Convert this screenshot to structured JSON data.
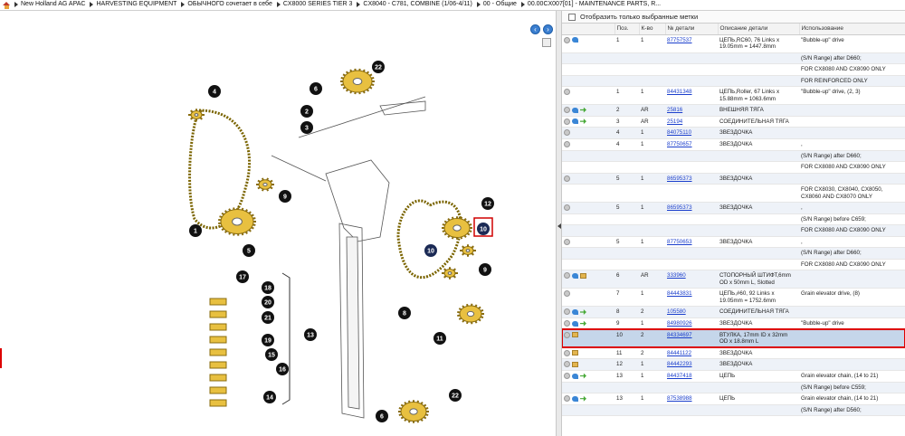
{
  "breadcrumb": [
    "New Holland AG APAC",
    "HARVESTING EQUIPMENT",
    "ОБЫЧНОГО сочетает в себе",
    "CX8000 SERIES TIER 3",
    "CX8040 - C781, COMBINE (1/06-4/11)",
    "00 - Общие",
    "00.00CX007[01] - MAINTENANCE PARTS, R..."
  ],
  "diagram": {
    "callouts": [
      "22",
      "4",
      "6",
      "2",
      "3",
      "9",
      "1",
      "12",
      "5",
      "10",
      "10",
      "9",
      "17",
      "18",
      "20",
      "21",
      "19",
      "15",
      "16",
      "14",
      "13",
      "8",
      "11",
      "6",
      "22"
    ],
    "colors": {
      "part": "#e8c040",
      "callout": "#111111",
      "highlight": "#d00000"
    }
  },
  "filter_label": "Отобразить только выбранные метки",
  "columns": [
    "",
    "Поз.",
    "К-во",
    "№ детали",
    "Описание детали",
    "Использование"
  ],
  "rows": [
    {
      "icons": [
        "circle",
        "blue"
      ],
      "pos": "1",
      "qty": "1",
      "part": "87757537",
      "desc": "ЦЕПЬ,RC60, 76 Links x 19.05mm = 1447.8mm",
      "use": "\"Bubble-up\" drive"
    },
    {
      "icons": [],
      "pos": "",
      "qty": "",
      "part": "",
      "desc": "",
      "use": "(S/N Range) after D660;"
    },
    {
      "icons": [],
      "pos": "",
      "qty": "",
      "part": "",
      "desc": "",
      "use": "FOR CX8080 AND CX8090 ONLY"
    },
    {
      "icons": [],
      "pos": "",
      "qty": "",
      "part": "",
      "desc": "",
      "use": "FOR REINFORCED ONLY"
    },
    {
      "icons": [
        "circle"
      ],
      "pos": "1",
      "qty": "1",
      "part": "84431348",
      "desc": "ЦЕПЬ,Roller, 67 Links x 15.88mm = 1063.6mm",
      "use": "\"Bubble-up\" drive, (2, 3)"
    },
    {
      "icons": [
        "circle",
        "blue",
        "green"
      ],
      "pos": "2",
      "qty": "AR",
      "part": "25816",
      "desc": "ВНЕШНЯЯ ТЯГА",
      "use": ""
    },
    {
      "icons": [
        "circle",
        "blue",
        "green"
      ],
      "pos": "3",
      "qty": "AR",
      "part": "25194",
      "desc": "СОЕДИНИТЕЛЬНАЯ ТЯГА",
      "use": ""
    },
    {
      "icons": [
        "circle"
      ],
      "pos": "4",
      "qty": "1",
      "part": "84075110",
      "desc": "ЗВЕЗДОЧКА",
      "use": ""
    },
    {
      "icons": [
        "circle"
      ],
      "pos": "4",
      "qty": "1",
      "part": "87750657",
      "desc": "ЗВЕЗДОЧКА",
      "use": ","
    },
    {
      "icons": [],
      "pos": "",
      "qty": "",
      "part": "",
      "desc": "",
      "use": "(S/N Range) after D660;"
    },
    {
      "icons": [],
      "pos": "",
      "qty": "",
      "part": "",
      "desc": "",
      "use": "FOR CX8080 AND CX8090 ONLY"
    },
    {
      "icons": [
        "circle"
      ],
      "pos": "5",
      "qty": "1",
      "part": "86595373",
      "desc": "ЗВЕЗДОЧКА",
      "use": ""
    },
    {
      "icons": [],
      "pos": "",
      "qty": "",
      "part": "",
      "desc": "",
      "use": "FOR CX8030, CX8040, CX8050, CX8060 AND CX8070 ONLY"
    },
    {
      "icons": [
        "circle"
      ],
      "pos": "5",
      "qty": "1",
      "part": "86595373",
      "desc": "ЗВЕЗДОЧКА",
      "use": ","
    },
    {
      "icons": [],
      "pos": "",
      "qty": "",
      "part": "",
      "desc": "",
      "use": "(S/N Range) before C659;"
    },
    {
      "icons": [],
      "pos": "",
      "qty": "",
      "part": "",
      "desc": "",
      "use": "FOR CX8080 AND CX8090 ONLY"
    },
    {
      "icons": [
        "circle"
      ],
      "pos": "5",
      "qty": "1",
      "part": "87750653",
      "desc": "ЗВЕЗДОЧКА",
      "use": ","
    },
    {
      "icons": [],
      "pos": "",
      "qty": "",
      "part": "",
      "desc": "",
      "use": "(S/N Range) after D660;"
    },
    {
      "icons": [],
      "pos": "",
      "qty": "",
      "part": "",
      "desc": "",
      "use": "FOR CX8080 AND CX8090 ONLY"
    },
    {
      "icons": [
        "circle",
        "blue",
        "box"
      ],
      "pos": "6",
      "qty": "AR",
      "part": "333960",
      "desc": "СТОПОРНЫЙ ШТИФТ,6mm OD x 50mm L, Slotted",
      "use": ""
    },
    {
      "icons": [
        "circle"
      ],
      "pos": "7",
      "qty": "1",
      "part": "84443831",
      "desc": "ЦЕПЬ,#60, 92 Links x 19.05mm = 1752.6mm",
      "use": "Grain elevator drive, (8)"
    },
    {
      "icons": [
        "circle",
        "blue",
        "green"
      ],
      "pos": "8",
      "qty": "2",
      "part": "105580",
      "desc": "СОЕДИНИТЕЛЬНАЯ ТЯГА",
      "use": ""
    },
    {
      "icons": [
        "circle",
        "blue",
        "green"
      ],
      "pos": "9",
      "qty": "1",
      "part": "84980926",
      "desc": "ЗВЕЗДОЧКА",
      "use": "\"Bubble-up\" drive"
    },
    {
      "icons": [
        "circle",
        "box"
      ],
      "pos": "10",
      "qty": "2",
      "part": "84334697",
      "desc": "ВТУЛКА, 17mm ID x 32mm OD x 18.8mm L",
      "use": "",
      "selected": true
    },
    {
      "icons": [
        "circle",
        "box"
      ],
      "pos": "11",
      "qty": "2",
      "part": "84441122",
      "desc": "ЗВЕЗДОЧКА",
      "use": ""
    },
    {
      "icons": [
        "circle",
        "box"
      ],
      "pos": "12",
      "qty": "1",
      "part": "84442293",
      "desc": "ЗВЕЗДОЧКА",
      "use": ""
    },
    {
      "icons": [
        "circle",
        "blue",
        "green"
      ],
      "pos": "13",
      "qty": "1",
      "part": "84437418",
      "desc": "ЦЕПЬ",
      "use": "Grain elevator chain, (14 to 21)"
    },
    {
      "icons": [],
      "pos": "",
      "qty": "",
      "part": "",
      "desc": "",
      "use": "(S/N Range) before C559;"
    },
    {
      "icons": [
        "circle",
        "blue",
        "green"
      ],
      "pos": "13",
      "qty": "1",
      "part": "87538988",
      "desc": "ЦЕПЬ",
      "use": "Grain elevator chain, (14 to 21)"
    },
    {
      "icons": [],
      "pos": "",
      "qty": "",
      "part": "",
      "desc": "",
      "use": "(S/N Range) after D560;"
    }
  ]
}
